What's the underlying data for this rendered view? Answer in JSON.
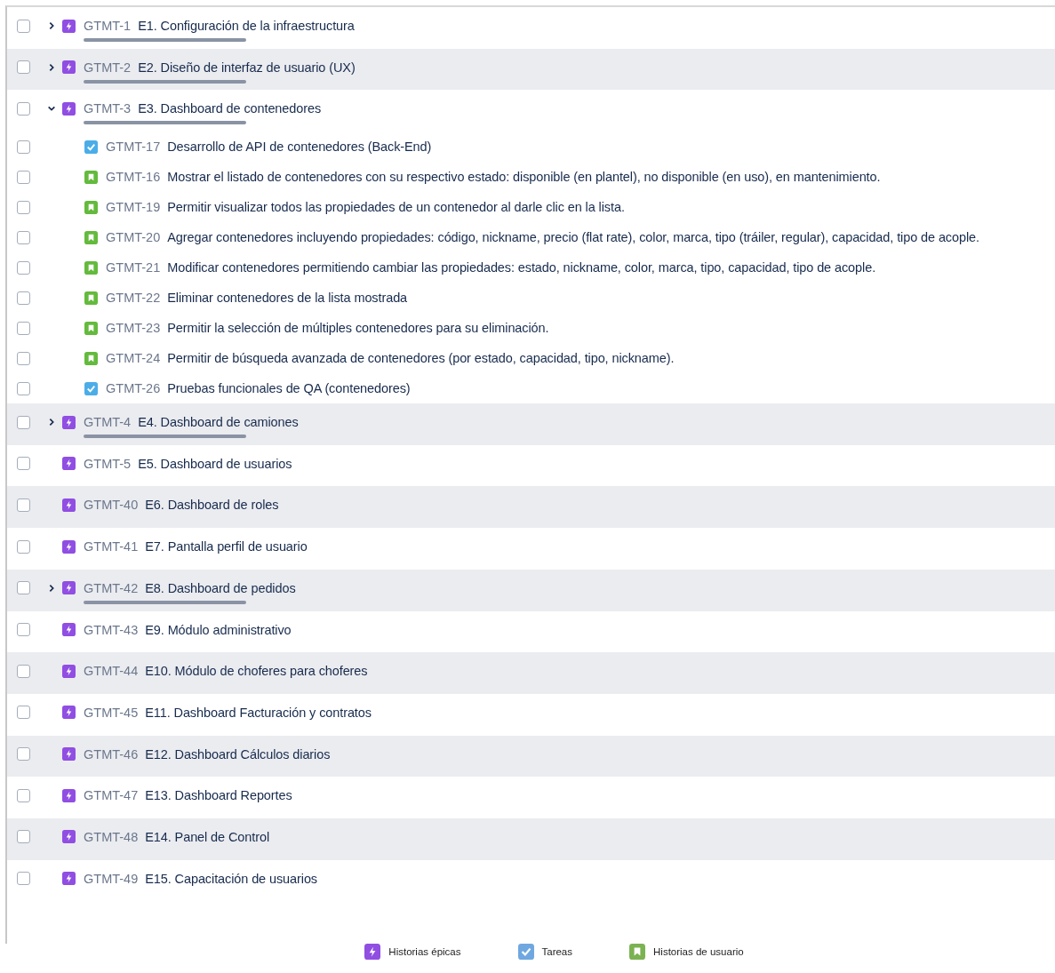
{
  "epics": [
    {
      "key": "GTMT-1",
      "title": "E1. Configuración de la infraestructura",
      "checked": false,
      "expanded": false
    },
    {
      "key": "GTMT-2",
      "title": "E2. Diseño de interfaz de usuario (UX)",
      "checked": false,
      "expanded": false
    },
    {
      "key": "GTMT-3",
      "title": "E3. Dashboard de contenedores",
      "checked": false,
      "expanded": true,
      "children": [
        {
          "kind": "task",
          "key": "GTMT-17",
          "title": "Desarrollo de API de contenedores (Back-End)",
          "checked": false
        },
        {
          "kind": "story",
          "key": "GTMT-16",
          "title": "Mostrar el listado de contenedores con su respectivo estado: disponible (en plantel), no disponible (en uso), en mantenimiento.",
          "checked": false
        },
        {
          "kind": "story",
          "key": "GTMT-19",
          "title": "Permitir visualizar todos las propiedades de un contenedor al darle clic en la lista.",
          "checked": false
        },
        {
          "kind": "story",
          "key": "GTMT-20",
          "title": "Agregar contenedores incluyendo propiedades: código, nickname, precio (flat rate), color, marca, tipo (tráiler, regular), capacidad, tipo de acople.",
          "checked": false
        },
        {
          "kind": "story",
          "key": "GTMT-21",
          "title": "Modificar contenedores permitiendo cambiar las propiedades: estado, nickname, color, marca, tipo, capacidad, tipo de acople.",
          "checked": false
        },
        {
          "kind": "story",
          "key": "GTMT-22",
          "title": "Eliminar contenedores de la lista mostrada",
          "checked": false
        },
        {
          "kind": "story",
          "key": "GTMT-23",
          "title": "Permitir la selección de múltiples contenedores para su eliminación.",
          "checked": false
        },
        {
          "kind": "story",
          "key": "GTMT-24",
          "title": "Permitir de búsqueda avanzada de contenedores (por estado, capacidad, tipo, nickname).",
          "checked": false
        },
        {
          "kind": "task",
          "key": "GTMT-26",
          "title": "Pruebas funcionales de QA (contenedores)",
          "checked": false
        }
      ]
    },
    {
      "key": "GTMT-4",
      "title": "E4. Dashboard de camiones",
      "checked": false,
      "expanded": false
    },
    {
      "key": "GTMT-5",
      "title": "E5. Dashboard de usuarios",
      "checked": false
    },
    {
      "key": "GTMT-40",
      "title": "E6. Dashboard de roles",
      "checked": false
    },
    {
      "key": "GTMT-41",
      "title": "E7. Pantalla perfil de usuario",
      "checked": false
    },
    {
      "key": "GTMT-42",
      "title": "E8. Dashboard de pedidos",
      "checked": false,
      "expanded": false
    },
    {
      "key": "GTMT-43",
      "title": "E9. Módulo administrativo",
      "checked": false
    },
    {
      "key": "GTMT-44",
      "title": "E10. Módulo de choferes para choferes",
      "checked": false
    },
    {
      "key": "GTMT-45",
      "title": "E11. Dashboard Facturación y contratos",
      "checked": false
    },
    {
      "key": "GTMT-46",
      "title": "E12. Dashboard Cálculos diarios",
      "checked": false
    },
    {
      "key": "GTMT-47",
      "title": "E13. Dashboard Reportes",
      "checked": false
    },
    {
      "key": "GTMT-48",
      "title": "E14. Panel de Control",
      "checked": false
    },
    {
      "key": "GTMT-49",
      "title": "E15. Capacitación de usuarios",
      "checked": false
    }
  ],
  "legend": [
    {
      "kind": "epic",
      "label": "Historias épicas"
    },
    {
      "kind": "task",
      "label": "Tareas"
    },
    {
      "kind": "story",
      "label": "Historias de usuario"
    }
  ]
}
